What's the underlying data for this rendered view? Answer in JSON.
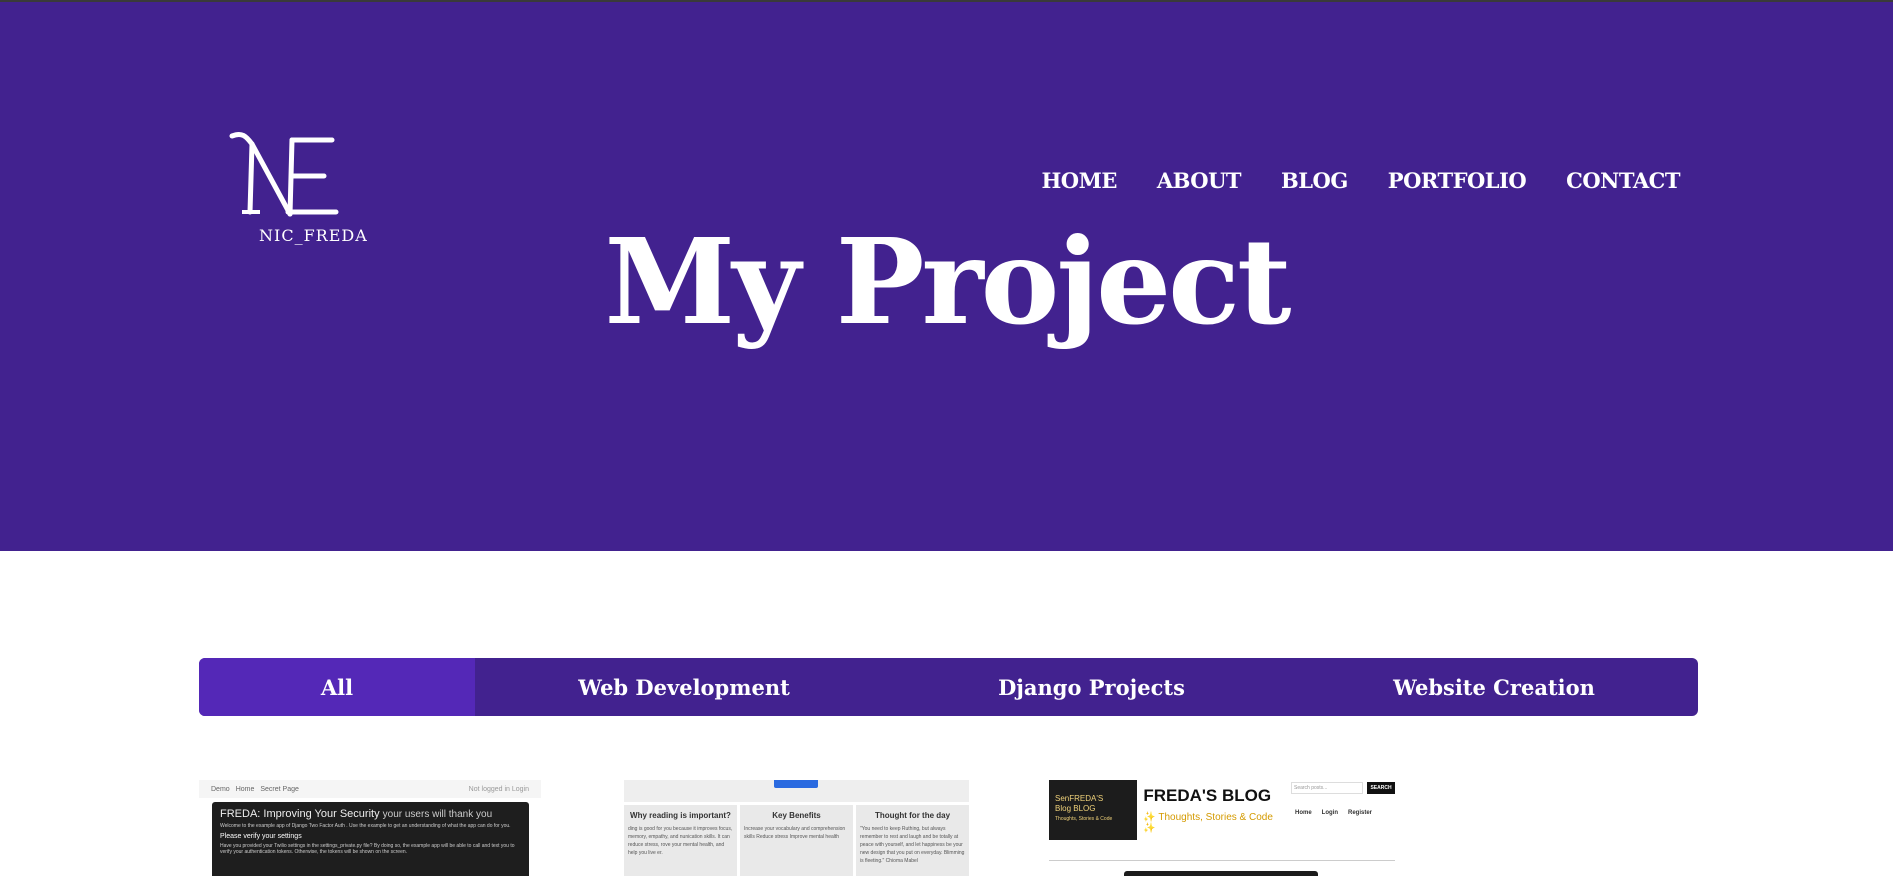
{
  "brand": {
    "logo_text": "NIC_FREDA"
  },
  "nav": {
    "items": [
      {
        "label": "HOME"
      },
      {
        "label": "ABOUT"
      },
      {
        "label": "BLOG"
      },
      {
        "label": "PORTFOLIO"
      },
      {
        "label": "CONTACT"
      }
    ]
  },
  "hero": {
    "title": "My Project"
  },
  "filters": {
    "active": "All",
    "items": [
      {
        "label": "All"
      },
      {
        "label": "Web Development"
      },
      {
        "label": "Django Projects"
      },
      {
        "label": "Website Creation"
      }
    ]
  },
  "projects": [
    {
      "nav_left": "Demo",
      "nav_home": "Home",
      "nav_second": "Secret Page",
      "nav_right": "Not logged in  Login",
      "heading": "FREDA: Improving Your Security",
      "heading_suffix": "your users will thank you",
      "intro": "Welcome to the example app of  Django Two Factor Auth . Use the example to get an understanding of what the app can do for you.",
      "subheading": "Please verify your settings",
      "body": "Have you provided your Twilio settings in the  settings_private.py  file? By doing so, the example app will be able to call and text you to verify your authentication tokens. Otherwise, the tokens will be shown on the screen."
    },
    {
      "columns": [
        {
          "title": "Why reading is important?",
          "text": "ding is good for you because it improves focus, memory, empathy, and nunication skills. It can reduce stress, rove your mental health, and help you live er."
        },
        {
          "title": "Key Benefits",
          "text": "Increase your vocabulary and comprehension skills  Reduce stress  Improve mental health"
        },
        {
          "title": "Thought for the day",
          "text": "\"You need to keep Ruthing, but always remember to rest and laugh and be totally at peace with yourself, and let happiness be your new design that you put on everyday. Blimming is fleeting.\" Chioma Mabel"
        }
      ]
    },
    {
      "badge_line1": "SenFREDA'S",
      "badge_line2": "Blog BLOG",
      "badge_line3": "Thoughts, Stories & Code",
      "title": "FREDA'S BLOG",
      "tagline": "✨ Thoughts, Stories & Code ✨",
      "search_placeholder": "Search posts...",
      "search_button": "SEARCH",
      "links": [
        "Home",
        "Login",
        "Register"
      ]
    }
  ],
  "colors": {
    "hero_bg": "#42228f",
    "active_filter": "#5428b7",
    "text_on_brand": "#ffffff"
  }
}
